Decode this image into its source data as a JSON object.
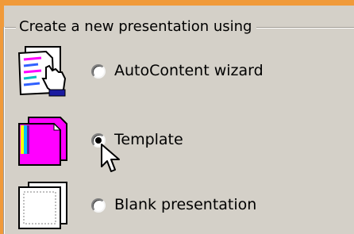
{
  "window": {
    "accent_color": "#f09a3a",
    "background_color": "#d4d0c8"
  },
  "group": {
    "title": "Create a new presentation using"
  },
  "options": [
    {
      "label": "AutoContent wizard",
      "icon": "autocontent-wizard-icon",
      "selected": false
    },
    {
      "label": "Template",
      "icon": "template-icon",
      "selected": true
    },
    {
      "label": "Blank presentation",
      "icon": "blank-presentation-icon",
      "selected": false
    }
  ],
  "cursor": {
    "icon": "arrow-cursor-icon"
  }
}
